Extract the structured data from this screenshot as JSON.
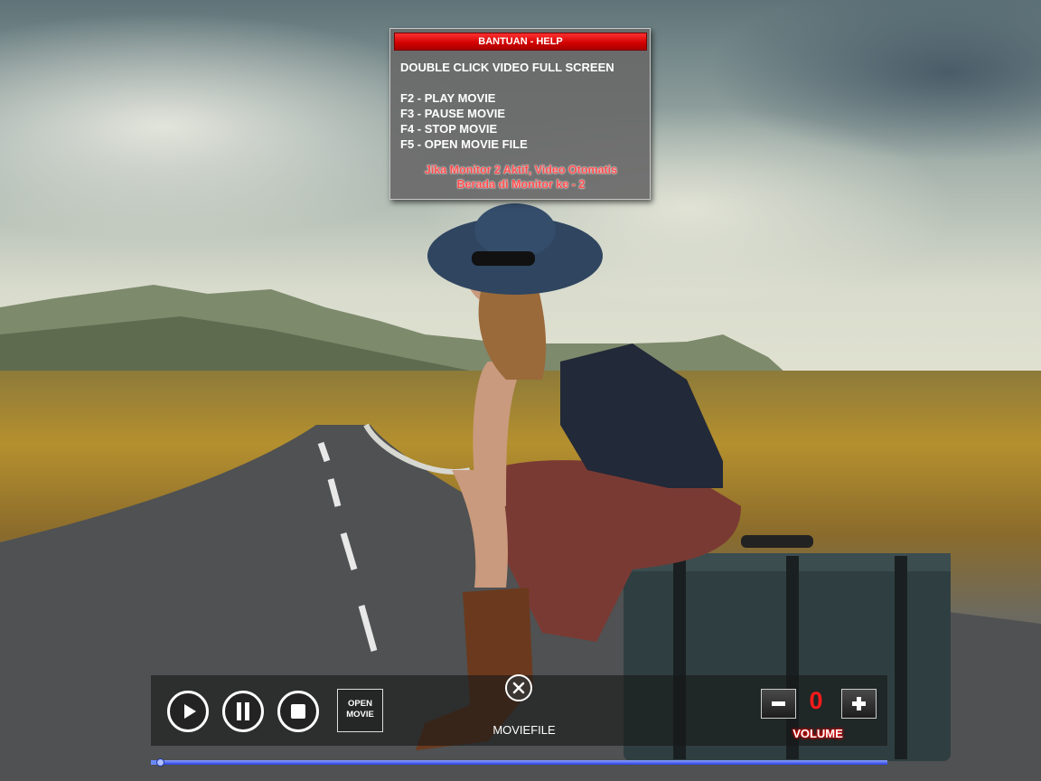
{
  "help": {
    "title": "BANTUAN - HELP",
    "main": "DOUBLE CLICK VIDEO FULL SCREEN",
    "keys": [
      "F2 - PLAY MOVIE",
      "F3 - PAUSE MOVIE",
      "F4 - STOP MOVIE",
      "F5 - OPEN MOVIE FILE"
    ],
    "note_line1": "Jika Monitor 2 Aktif, Video Otomatis",
    "note_line2": "Berada di Monitor ke - 2"
  },
  "controls": {
    "play_icon": "play-icon",
    "pause_icon": "pause-icon",
    "stop_icon": "stop-icon",
    "open_label_line1": "OPEN",
    "open_label_line2": "MOVIE",
    "close_icon": "close-icon",
    "movie_label": "MOVIEFILE",
    "volume_minus_icon": "minus-icon",
    "volume_plus_icon": "plus-icon",
    "volume_value": "0",
    "volume_label": "VOLUME",
    "progress": 0.012
  },
  "colors": {
    "help_title": "#d00000",
    "note_text": "#ff4d4d",
    "volume_value": "#ff1a1a",
    "progress": "#2b3fe0"
  }
}
